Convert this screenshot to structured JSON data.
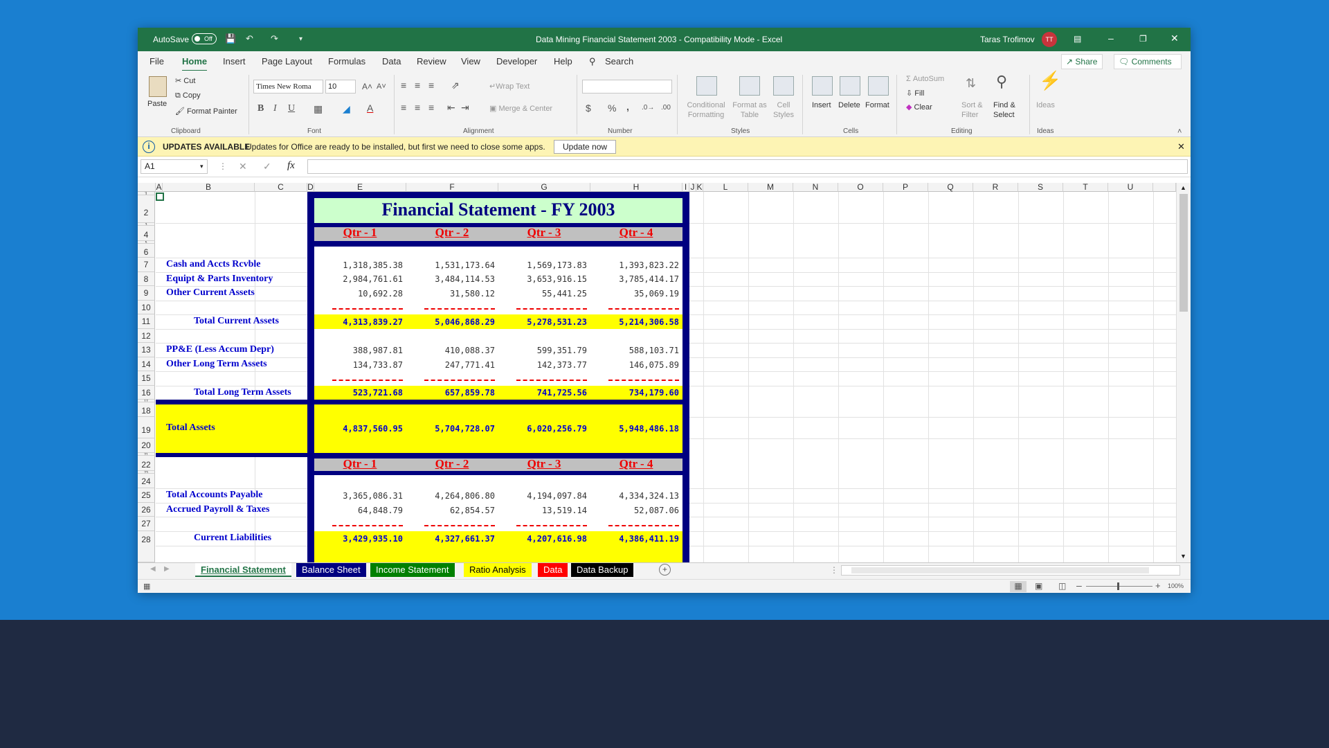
{
  "titlebar": {
    "autosave_label": "AutoSave",
    "autosave_state": "Off",
    "doc_title": "Data Mining Financial Statement  2003  -  Compatibility Mode  -  Excel",
    "user_name": "Taras Trofimov",
    "user_initials": "TT"
  },
  "menu": {
    "tabs": [
      "File",
      "Home",
      "Insert",
      "Page Layout",
      "Formulas",
      "Data",
      "Review",
      "View",
      "Developer",
      "Help"
    ],
    "search": "Search",
    "share": "Share",
    "comments": "Comments"
  },
  "ribbon": {
    "clipboard": {
      "paste": "Paste",
      "cut": "Cut",
      "copy": "Copy",
      "format_painter": "Format Painter",
      "label": "Clipboard"
    },
    "font": {
      "name": "Times New Roma",
      "size": "10",
      "bold": "B",
      "italic": "I",
      "underline": "U",
      "label": "Font"
    },
    "alignment": {
      "wrap": "Wrap Text",
      "merge": "Merge & Center",
      "label": "Alignment"
    },
    "number": {
      "currency": "$",
      "percent": "%",
      "comma": ",",
      "label": "Number"
    },
    "styles": {
      "conditional": "Conditional",
      "conditional2": "Formatting",
      "format_as": "Format as",
      "format_as2": "Table",
      "cell": "Cell",
      "cell2": "Styles",
      "label": "Styles"
    },
    "cells": {
      "insert": "Insert",
      "delete": "Delete",
      "format": "Format",
      "label": "Cells"
    },
    "editing": {
      "autosum": "AutoSum",
      "fill": "Fill",
      "clear": "Clear",
      "sort": "Sort &",
      "sort2": "Filter",
      "find": "Find &",
      "find2": "Select",
      "label": "Editing"
    },
    "ideas": {
      "label_btn": "Ideas",
      "label": "Ideas"
    }
  },
  "message_bar": {
    "title": "UPDATES AVAILABLE",
    "text": "Updates for Office are ready to be installed, but first we need to close some apps.",
    "button": "Update now"
  },
  "formula_bar": {
    "name_box": "A1",
    "fx": "fx",
    "cancel": "✕",
    "enter": "✓",
    "value": ""
  },
  "columns": [
    "A",
    "B",
    "C",
    "D",
    "E",
    "F",
    "G",
    "H",
    "I",
    "J",
    "K",
    "L",
    "M",
    "N",
    "O",
    "P",
    "Q",
    "R",
    "S",
    "T",
    "U"
  ],
  "rows": [
    "1",
    "2",
    "3",
    "4",
    "5",
    "6",
    "7",
    "8",
    "9",
    "10",
    "11",
    "12",
    "13",
    "14",
    "15",
    "16",
    "17",
    "18",
    "19",
    "20",
    "21",
    "22",
    "23",
    "24",
    "25",
    "26",
    "27",
    "28"
  ],
  "sheet": {
    "title": "Financial Statement  -  FY 2003",
    "quarters": [
      "Qtr - 1",
      "Qtr - 2",
      "Qtr - 3",
      "Qtr - 4"
    ],
    "dashes": "-------------",
    "lines": [
      {
        "label": "Cash and Accts Rcvble",
        "values": [
          "1,318,385.38",
          "1,531,173.64",
          "1,569,173.83",
          "1,393,823.22"
        ]
      },
      {
        "label": "Equipt & Parts Inventory",
        "values": [
          "2,984,761.61",
          "3,484,114.53",
          "3,653,916.15",
          "3,785,414.17"
        ]
      },
      {
        "label": "Other Current Assets",
        "values": [
          "10,692.28",
          "31,580.12",
          "55,441.25",
          "35,069.19"
        ]
      },
      {
        "label": "Total Current Assets",
        "values": [
          "4,313,839.27",
          "5,046,868.29",
          "5,278,531.23",
          "5,214,306.58"
        ]
      },
      {
        "label": "PP&E (Less Accum Depr)",
        "values": [
          "388,987.81",
          "410,088.37",
          "599,351.79",
          "588,103.71"
        ]
      },
      {
        "label": "Other Long Term Assets",
        "values": [
          "134,733.87",
          "247,771.41",
          "142,373.77",
          "146,075.89"
        ]
      },
      {
        "label": "Total Long Term Assets",
        "values": [
          "523,721.68",
          "657,859.78",
          "741,725.56",
          "734,179.60"
        ]
      },
      {
        "label": "Total Assets",
        "values": [
          "4,837,560.95",
          "5,704,728.07",
          "6,020,256.79",
          "5,948,486.18"
        ]
      },
      {
        "label": "Total Accounts Payable",
        "values": [
          "3,365,086.31",
          "4,264,806.80",
          "4,194,097.84",
          "4,334,324.13"
        ]
      },
      {
        "label": "Accrued Payroll & Taxes",
        "values": [
          "64,848.79",
          "62,854.57",
          "13,519.14",
          "52,087.06"
        ]
      },
      {
        "label": "Current Liabilities",
        "values": [
          "3,429,935.10",
          "4,327,661.37",
          "4,207,616.98",
          "4,386,411.19"
        ]
      }
    ]
  },
  "tabs": [
    {
      "label": "Financial Statement"
    },
    {
      "label": "Balance Sheet"
    },
    {
      "label": "Income Statement"
    },
    {
      "label": "Ratio Analysis"
    },
    {
      "label": "Data"
    },
    {
      "label": "Data Backup"
    }
  ],
  "status": {
    "zoom": "100%"
  },
  "colors": {
    "excel_green": "#217346",
    "navy": "#000080",
    "yellow": "#ffff00",
    "title_fill": "#ccffcc",
    "qtr_fill": "#c0c0c0",
    "label_blue": "#0000cc"
  }
}
